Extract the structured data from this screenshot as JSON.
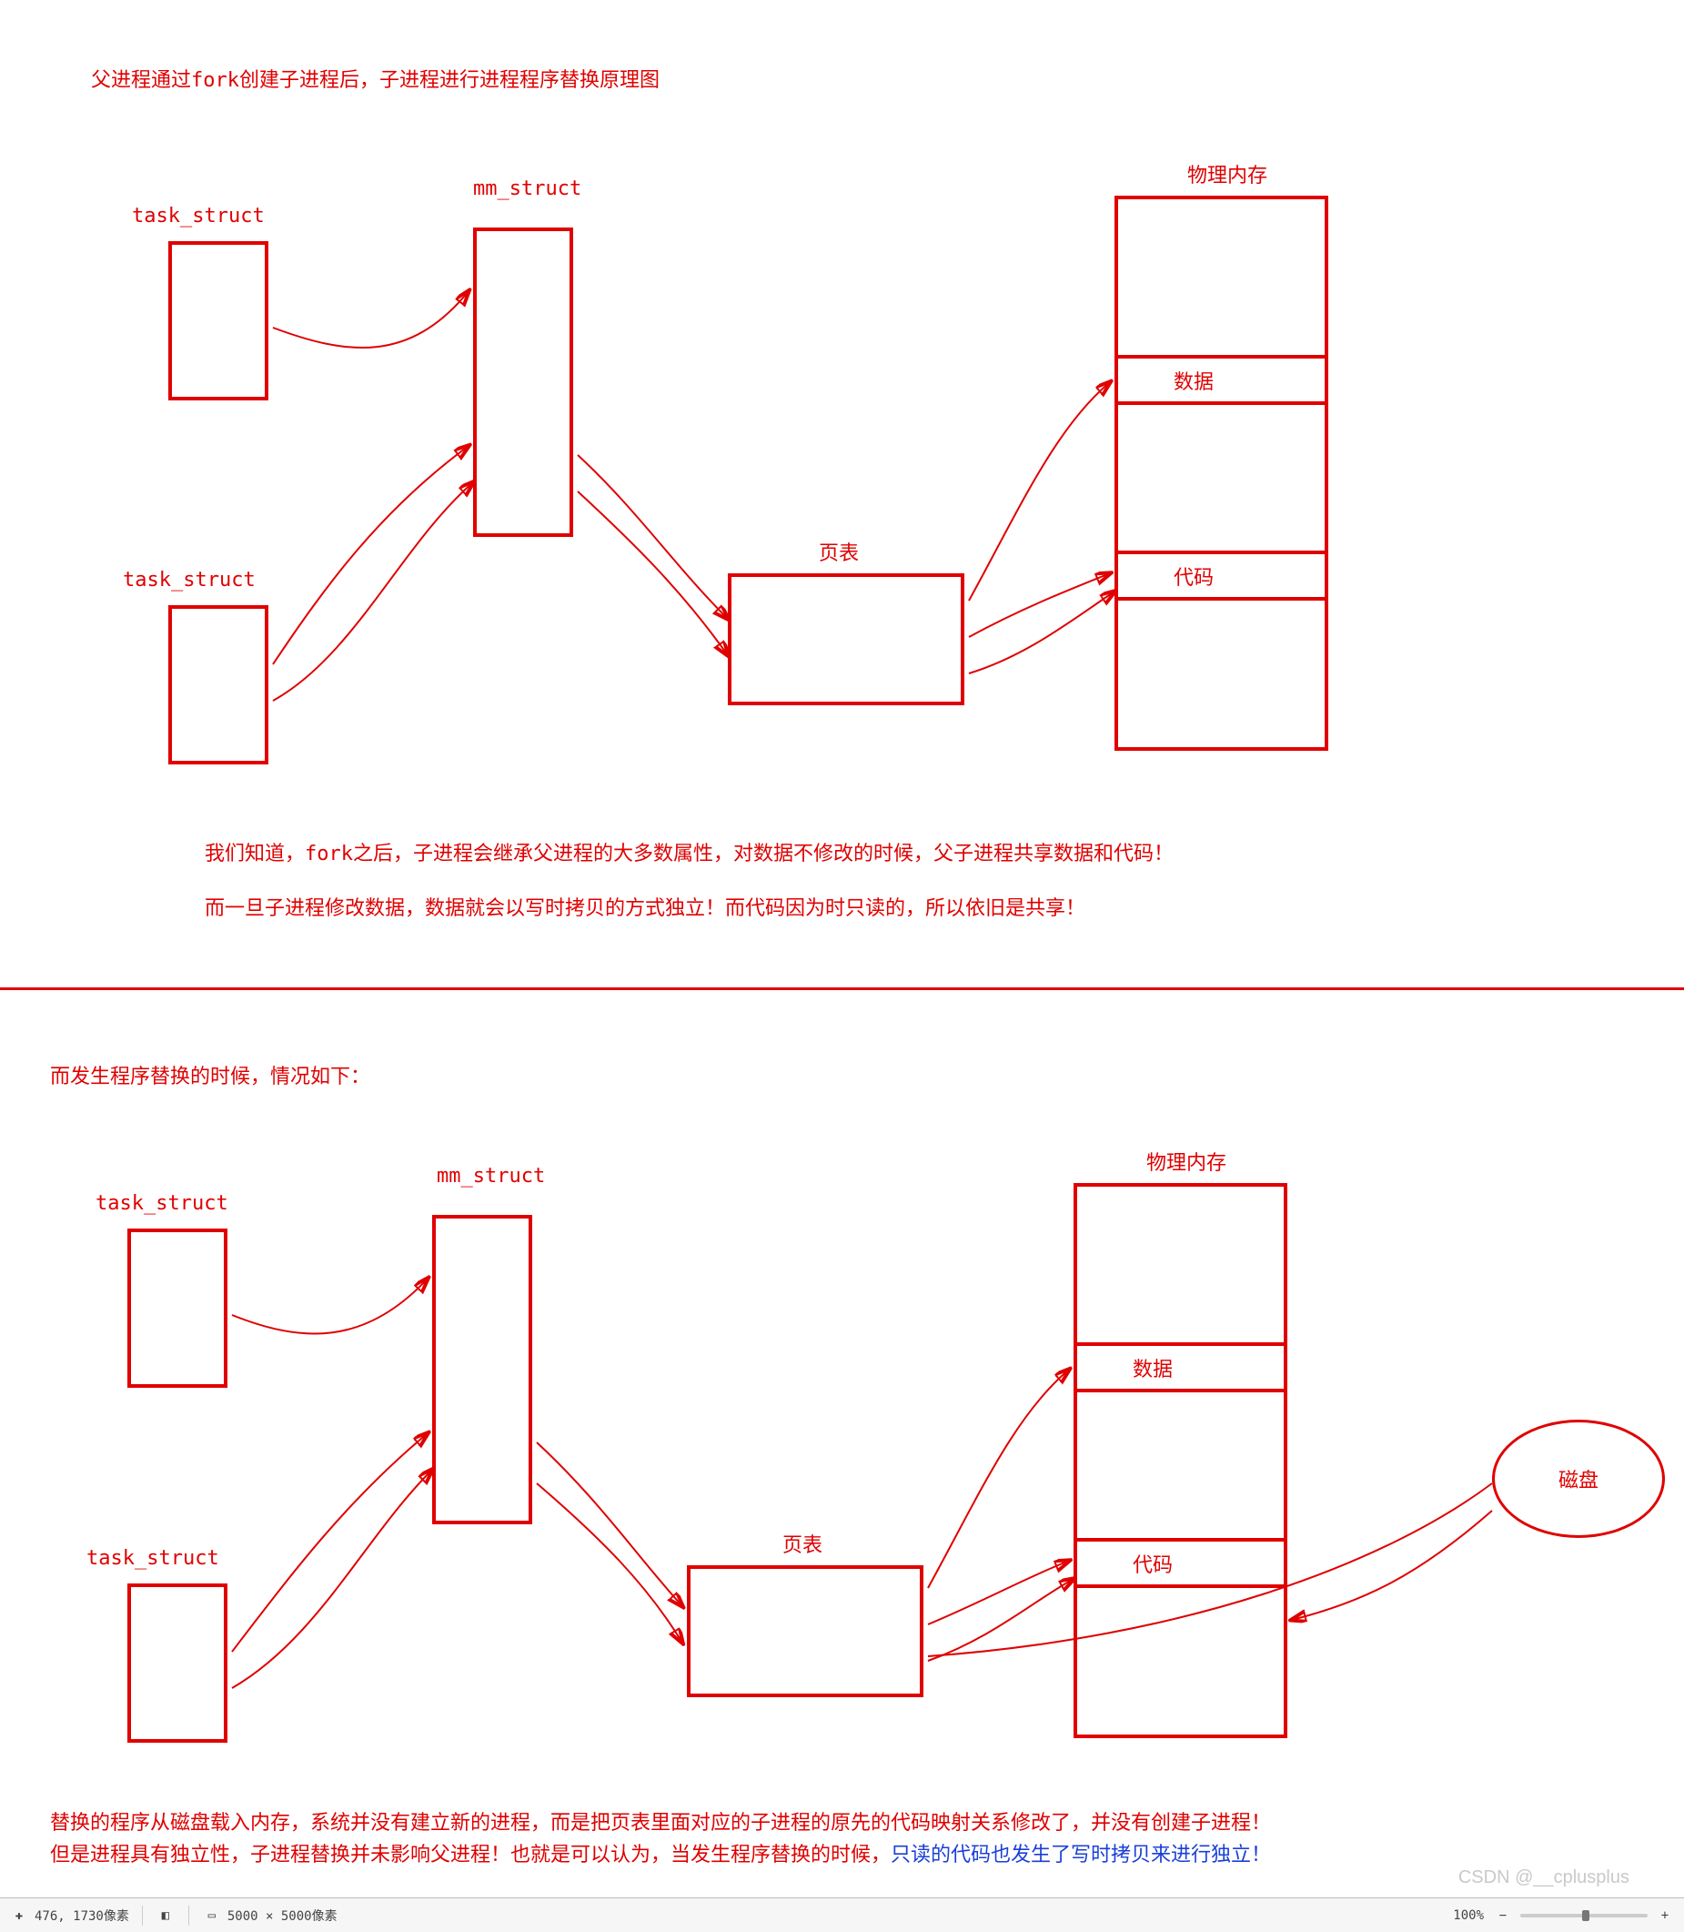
{
  "chart_data": [
    {
      "type": "diagram",
      "title": "父进程通过fork创建子进程后，子进程进行进程程序替换原理图",
      "nodes": [
        {
          "id": "task_struct_parent_1",
          "label": "task_struct"
        },
        {
          "id": "task_struct_child_1",
          "label": "task_struct"
        },
        {
          "id": "mm_struct_1",
          "label": "mm_struct"
        },
        {
          "id": "page_table_1",
          "label": "页表"
        },
        {
          "id": "phys_mem_1",
          "label": "物理内存",
          "segments": [
            "数据",
            "代码"
          ]
        }
      ],
      "edges": [
        [
          "task_struct_parent_1",
          "mm_struct_1"
        ],
        [
          "task_struct_child_1",
          "mm_struct_1"
        ],
        [
          "mm_struct_1",
          "page_table_1"
        ],
        [
          "page_table_1",
          "phys_mem_1.数据"
        ],
        [
          "page_table_1",
          "phys_mem_1.代码"
        ]
      ],
      "notes": [
        "我们知道，fork之后，子进程会继承父进程的大多数属性，对数据不修改的时候，父子进程共享数据和代码！",
        "而一旦子进程修改数据，数据就会以写时拷贝的方式独立！而代码因为时只读的，所以依旧是共享！"
      ]
    },
    {
      "type": "diagram",
      "title": "而发生程序替换的时候，情况如下：",
      "nodes": [
        {
          "id": "task_struct_parent_2",
          "label": "task_struct"
        },
        {
          "id": "task_struct_child_2",
          "label": "task_struct"
        },
        {
          "id": "mm_struct_2",
          "label": "mm_struct"
        },
        {
          "id": "page_table_2",
          "label": "页表"
        },
        {
          "id": "phys_mem_2",
          "label": "物理内存",
          "segments": [
            "数据",
            "代码"
          ]
        },
        {
          "id": "disk",
          "label": "磁盘"
        }
      ],
      "edges": [
        [
          "task_struct_parent_2",
          "mm_struct_2"
        ],
        [
          "task_struct_child_2",
          "mm_struct_2"
        ],
        [
          "mm_struct_2",
          "page_table_2"
        ],
        [
          "page_table_2",
          "phys_mem_2.数据"
        ],
        [
          "page_table_2",
          "phys_mem_2.代码"
        ],
        [
          "disk",
          "phys_mem_2"
        ]
      ],
      "notes": [
        "替换的程序从磁盘载入内存，系统并没有建立新的进程，而是把页表里面对应的子进程的原先的代码映射关系修改了，并没有创建子进程！",
        "但是进程具有独立性，子进程替换并未影响父进程！也就是可以认为，当发生程序替换的时候，只读的代码也发生了写时拷贝来进行独立！"
      ]
    }
  ],
  "diagram1": {
    "title": "父进程通过fork创建子进程后，子进程进行进程程序替换原理图",
    "task_struct_top": "task_struct",
    "task_struct_bottom": "task_struct",
    "mm_struct": "mm_struct",
    "page_table": "页表",
    "phys_mem_header": "物理内存",
    "seg_data": "数据",
    "seg_code": "代码",
    "note1": "我们知道，fork之后，子进程会继承父进程的大多数属性，对数据不修改的时候，父子进程共享数据和代码！",
    "note2": "而一旦子进程修改数据，数据就会以写时拷贝的方式独立！而代码因为时只读的，所以依旧是共享！"
  },
  "diagram2": {
    "title": "而发生程序替换的时候，情况如下：",
    "task_struct_top": "task_struct",
    "task_struct_bottom": "task_struct",
    "mm_struct": "mm_struct",
    "page_table": "页表",
    "phys_mem_header": "物理内存",
    "seg_data": "数据",
    "seg_code": "代码",
    "disk": "磁盘",
    "note1": "替换的程序从磁盘载入内存，系统并没有建立新的进程，而是把页表里面对应的子进程的原先的代码映射关系修改了，并没有创建子进程！",
    "note2a": "但是进程具有独立性，子进程替换并未影响父进程！也就是可以认为，当发生程序替换的时候，",
    "note2b": "只读的代码也发生了写时拷贝来进行独立！"
  },
  "watermark": "CSDN @__cplusplus",
  "statusbar": {
    "pos": "476, 1730像素",
    "dims": "5000 × 5000像素",
    "zoom": "100%",
    "minus": "−",
    "plus": "+"
  }
}
